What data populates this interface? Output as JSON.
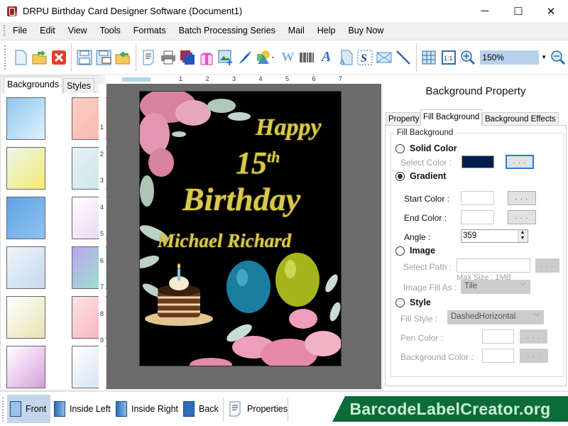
{
  "window": {
    "title": "DRPU Birthday Card Designer Software (Document1)",
    "controls": {
      "minimize": "─",
      "maximize": "☐",
      "close": "✕"
    }
  },
  "menu": [
    "File",
    "Edit",
    "View",
    "Tools",
    "Formats",
    "Batch Processing Series",
    "Mail",
    "Help",
    "Buy Now"
  ],
  "toolbar": {
    "icons": [
      "new-document",
      "open-folder",
      "close",
      "save",
      "save-as",
      "open-template",
      "properties",
      "print",
      "layers",
      "gift",
      "insert-image",
      "signature-pen",
      "shapes",
      "watermark",
      "barcode",
      "text",
      "word-art",
      "signature",
      "email",
      "line",
      "grid",
      "actual-size",
      "zoom-in"
    ],
    "zoom_value": "150%",
    "zoom_out": "zoom-out"
  },
  "left_panel": {
    "tabs": [
      {
        "label": "Backgrounds",
        "active": true
      },
      {
        "label": "Styles",
        "active": false
      }
    ],
    "thumbnails": [
      {
        "name": "clouds",
        "colors": [
          "#8cc8f0",
          "#dff1fc"
        ]
      },
      {
        "name": "pink-hearts",
        "colors": [
          "#fbcfc6",
          "#f6b6ad"
        ]
      },
      {
        "name": "daisies",
        "colors": [
          "#e9f6ef",
          "#f7ea6f"
        ]
      },
      {
        "name": "teddy-bears",
        "colors": [
          "#e7f2f6",
          "#c9e4e8"
        ]
      },
      {
        "name": "stars",
        "colors": [
          "#5fa4e6",
          "#8fc2f0"
        ]
      },
      {
        "name": "balloons",
        "colors": [
          "#ffffff",
          "#e7d2f0"
        ]
      },
      {
        "name": "bubbles",
        "colors": [
          "#eef4fb",
          "#c5d9ec"
        ]
      },
      {
        "name": "rainbow-swirl",
        "colors": [
          "#b7a8ef",
          "#9ce6c6"
        ]
      },
      {
        "name": "happy-birthday",
        "colors": [
          "#ffffff",
          "#e7e2b0"
        ]
      },
      {
        "name": "heart-stripes",
        "colors": [
          "#fde2e4",
          "#f6b1b9"
        ]
      },
      {
        "name": "colorful-hearts",
        "colors": [
          "#ffffff",
          "#d69fdc"
        ]
      },
      {
        "name": "balloon-bunches",
        "colors": [
          "#ffffff",
          "#cfe0f3"
        ]
      }
    ]
  },
  "rulers": {
    "horizontal": [
      "1",
      "2",
      "3",
      "4",
      "5",
      "6",
      "7"
    ],
    "vertical": [
      "1",
      "2",
      "3",
      "4",
      "5",
      "6",
      "7",
      "8",
      "9"
    ]
  },
  "card": {
    "line1": "Happy",
    "line2": "15",
    "line2_sup": "th",
    "line3": "Birthday",
    "line4": "Michael Richard",
    "text_color": "#d8c94a",
    "background": "#000000"
  },
  "right_panel": {
    "title": "Background Property",
    "tabs": [
      {
        "label": "Property",
        "active": false
      },
      {
        "label": "Fill Background",
        "active": true
      },
      {
        "label": "Background Effects",
        "active": false
      }
    ],
    "group_label": "Fill Background",
    "solid_color": {
      "label": "Solid Color",
      "selected": false,
      "select_color_label": "Select Color :",
      "color": "#001f4d",
      "button": ". . ."
    },
    "gradient": {
      "label": "Gradient",
      "selected": true,
      "start_color_label": "Start Color :",
      "end_color_label": "End Color :",
      "angle_label": "Angle :",
      "angle_value": "359",
      "button": ". . ."
    },
    "image": {
      "label": "Image",
      "selected": false,
      "select_path_label": "Select Path :",
      "max_size": "Max Size : 1MB",
      "fill_as_label": "Image Fill As :",
      "fill_as_value": "Tile",
      "button": ". . ."
    },
    "style": {
      "label": "Style",
      "selected": false,
      "fill_style_label": "Fill Style :",
      "fill_style_value": "DashedHorizontal",
      "pen_color_label": "Pen Color :",
      "background_color_label": "Background Color :",
      "button": ". . ."
    }
  },
  "bottom_bar": {
    "items": [
      {
        "label": "Front",
        "active": true
      },
      {
        "label": "Inside Left",
        "active": false
      },
      {
        "label": "Inside Right",
        "active": false
      },
      {
        "label": "Back",
        "active": false
      },
      {
        "label": "Properties",
        "active": false
      }
    ]
  },
  "brand": {
    "text": "BarcodeLabelCreator.org",
    "color": "#0d6b3a",
    "text_color": "#c9f1d6"
  }
}
